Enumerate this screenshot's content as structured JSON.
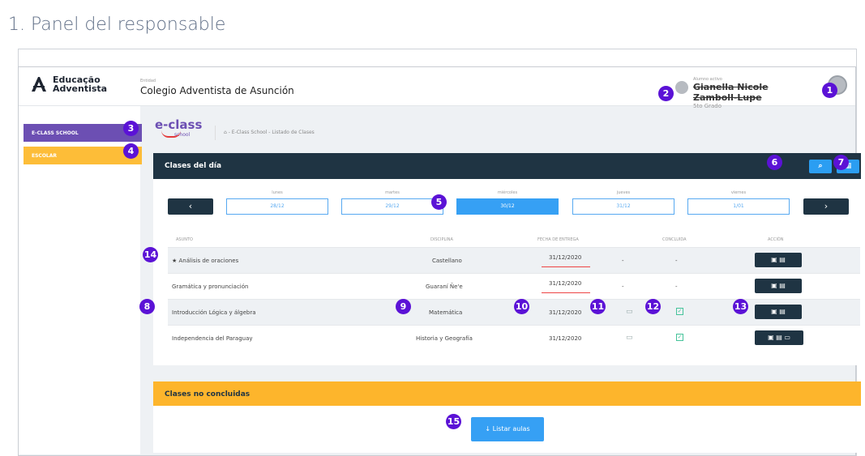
{
  "doc_title": "1. Panel del responsable",
  "header": {
    "logo_text": "Educação Adventista",
    "school_label": "Entidad",
    "school_name": "Colegio Adventista de Asunción",
    "student_label": "Alumno activo",
    "student_name": "Gianella Nicole Zamboll-Lupe",
    "student_grade": "5to Grado"
  },
  "sidebar": {
    "items": [
      {
        "label": "E-CLASS SCHOOL"
      },
      {
        "label": "ESCOLAR"
      }
    ]
  },
  "brand": {
    "main": "e-class",
    "sub": "school"
  },
  "breadcrumb": "⌂ - E-Class School - Listado de Clases",
  "panel": {
    "title": "Clases del día",
    "days": [
      {
        "name": "lunes",
        "date": "28/12"
      },
      {
        "name": "martes",
        "date": "29/12"
      },
      {
        "name": "miércoles",
        "date": "30/12"
      },
      {
        "name": "jueves",
        "date": "31/12"
      },
      {
        "name": "viernes",
        "date": "1/01"
      }
    ],
    "columns": [
      "ASUNTO",
      "DISCIPLINA",
      "FECHA DE ENTREGA",
      "CONCLUIDA",
      "ACCIÓN"
    ],
    "rows": [
      {
        "subject": "★ Análisis de oraciones",
        "discipline": "Castellano",
        "date": "31/12/2020",
        "c1": "-",
        "c2": "-"
      },
      {
        "subject": "Gramática y pronunciación",
        "discipline": "Guaraní Ñe'e",
        "date": "31/12/2020",
        "c1": "-",
        "c2": "-"
      },
      {
        "subject": "Introducción Lógica y álgebra",
        "discipline": "Matemática",
        "date": "31/12/2020",
        "c1": "",
        "c2": ""
      },
      {
        "subject": "Independencia del Paraguay",
        "discipline": "Historia y Geografía",
        "date": "31/12/2020",
        "c1": "",
        "c2": ""
      }
    ]
  },
  "panel2": {
    "title": "Clases no concluidas",
    "button": "↓ Listar aulas"
  },
  "badges": [
    "1",
    "2",
    "3",
    "4",
    "5",
    "6",
    "7",
    "8",
    "9",
    "10",
    "11",
    "12",
    "13",
    "14",
    "15"
  ],
  "colors": {
    "purple": "#6c4fb3",
    "yellow": "#fdbd38",
    "navy": "#1f3443",
    "blue": "#36a0f4",
    "badge": "#5b12d6"
  }
}
